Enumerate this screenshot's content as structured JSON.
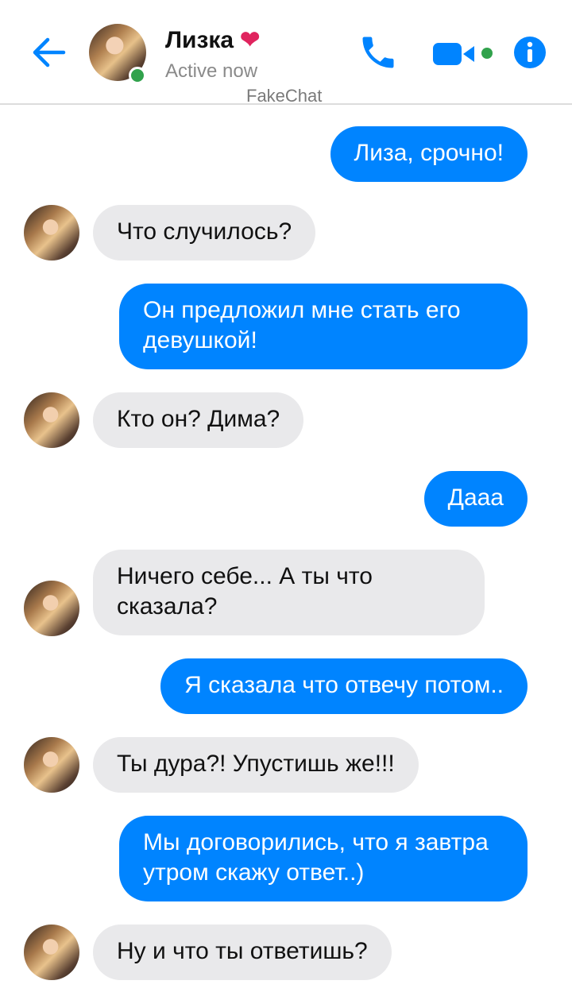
{
  "header": {
    "contact_name": "Лизка",
    "status": "Active now",
    "watermark": "FakeChat"
  },
  "colors": {
    "accent": "#0084ff",
    "incoming_bubble": "#e9e9eb",
    "online": "#31a24c",
    "heart": "#e0245e"
  },
  "icons": [
    "back-arrow-icon",
    "heart-icon",
    "phone-icon",
    "video-camera-icon",
    "info-icon"
  ],
  "messages": [
    {
      "dir": "out",
      "text": "Лиза, срочно!"
    },
    {
      "dir": "in",
      "text": "Что случилось?"
    },
    {
      "dir": "out",
      "text": "Он предложил мне стать его девушкой!"
    },
    {
      "dir": "in",
      "text": "Кто он? Дима?"
    },
    {
      "dir": "out",
      "text": "Дааа"
    },
    {
      "dir": "in",
      "text": "Ничего себе... А ты что сказала?"
    },
    {
      "dir": "out",
      "text": "Я сказала что отвечу потом.."
    },
    {
      "dir": "in",
      "text": "Ты дура?! Упустишь же!!!"
    },
    {
      "dir": "out",
      "text": "Мы договорились, что я завтра утром скажу ответ..)"
    },
    {
      "dir": "in",
      "text": "Ну и что ты ответишь?"
    }
  ]
}
